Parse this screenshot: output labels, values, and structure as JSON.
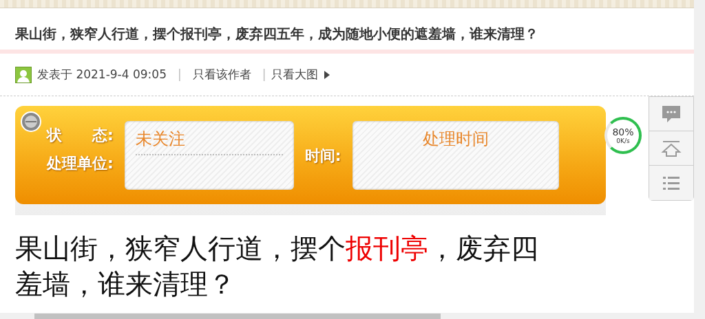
{
  "title": "果山街，狭窄人行道，摆个报刊亭，废弃四五年，成为随地小便的遮羞墙，谁来清理？",
  "post_meta": {
    "posted": "发表于 2021-9-4 09:05",
    "separators": [
      "|",
      "|"
    ],
    "author_only": "只看该作者",
    "large_images": "只看大图"
  },
  "status_panel": {
    "status_label": "状　　态:",
    "unit_label": "处理单位:",
    "status_value": "未关注",
    "time_label": "时间:",
    "time_value": "处理时间"
  },
  "speed_meter": {
    "percent": "80%",
    "speed": "0K/s"
  },
  "side_tools": [
    {
      "kind": "comment"
    },
    {
      "kind": "top"
    },
    {
      "kind": "list"
    }
  ],
  "body": {
    "lines": [
      "果山街，狭窄人行道，摆个**报刊亭**，废弃四",
      "羞墙，谁来清理？"
    ]
  }
}
